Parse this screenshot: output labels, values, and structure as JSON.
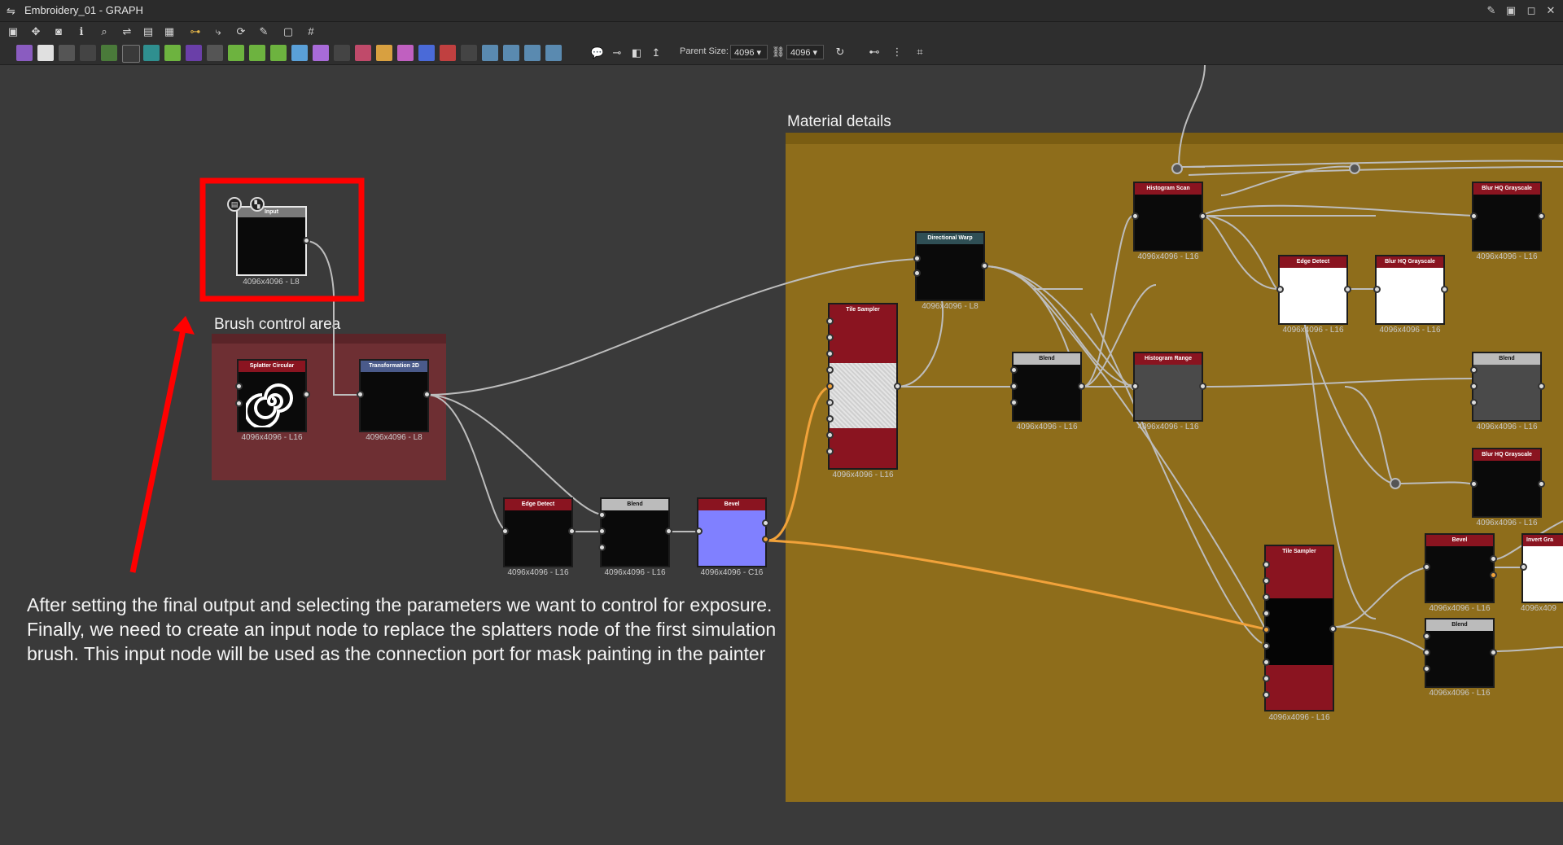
{
  "window": {
    "title": "Embroidery_01 - GRAPH"
  },
  "toolbar": {
    "parent_size_label": "Parent Size:",
    "parent_size_value": "4096",
    "size_value": "4096",
    "icons": [
      "frame-all-icon",
      "pan-icon",
      "camera-icon",
      "info-icon",
      "zoom-icon",
      "link-icon",
      "layout-icon",
      "align-icon",
      "connect-icon",
      "wire-icon",
      "refresh-icon",
      "wrench-icon",
      "snapshot-icon",
      "grid-icon"
    ]
  },
  "frames": {
    "material_details": "Material details",
    "brush_control": "Brush control area"
  },
  "nodes": {
    "input": {
      "title": "Input",
      "size": "4096x4096 - L8"
    },
    "splatter": {
      "title": "Splatter Circular",
      "size": "4096x4096 - L16"
    },
    "transformation": {
      "title": "Transformation 2D",
      "size": "4096x4096 - L8"
    },
    "edge_detect_1": {
      "title": "Edge Detect",
      "size": "4096x4096 - L16"
    },
    "blend_1": {
      "title": "Blend",
      "size": "4096x4096 - L16"
    },
    "bevel_1": {
      "title": "Bevel",
      "size": "4096x4096 - C16"
    },
    "tile_sampler_1": {
      "title": "Tile Sampler",
      "size": "4096x4096 - L16"
    },
    "directional_warp": {
      "title": "Directional Warp",
      "size": "4096x4096 - L8"
    },
    "blend_2": {
      "title": "Blend",
      "size": "4096x4096 - L16"
    },
    "histogram_scan": {
      "title": "Histogram Scan",
      "size": "4096x4096 - L16"
    },
    "histogram_range": {
      "title": "Histogram Range",
      "size": "4096x4096 - L16"
    },
    "edge_detect_2": {
      "title": "Edge Detect",
      "size": "4096x4096 - L16"
    },
    "blur_hq_1": {
      "title": "Blur HQ Grayscale",
      "size": "4096x4096 - L16"
    },
    "blur_hq_2": {
      "title": "Blur HQ Grayscale",
      "size": "4096x4096 - L16"
    },
    "blend_3": {
      "title": "Blend",
      "size": "4096x4096 - L16"
    },
    "blur_hq_3": {
      "title": "Blur HQ Grayscale",
      "size": "4096x4096 - L16"
    },
    "tile_sampler_2": {
      "title": "Tile Sampler",
      "size": "4096x4096 - L16"
    },
    "bevel_2": {
      "title": "Bevel",
      "size": "4096x4096 - L16"
    },
    "invert": {
      "title": "Invert Gra",
      "size": "4096x409"
    },
    "blend_4": {
      "title": "Blend",
      "size": "4096x4096 - L16"
    }
  },
  "annotation": {
    "text": "After setting the final output and selecting the parameters we want to control for exposure. Finally, we need to create an input node to replace the splatters node of the first simulation brush. This input node will be used as the connection port for mask painting in the painter"
  },
  "colors": {
    "canvas": "#3a3a3a",
    "material_frame": "#8e6d1b",
    "brush_frame": "#6e2f33",
    "highlight": "#ff0000",
    "node_header_red": "#8a1420",
    "wire": "#bdbdbd",
    "wire_orange": "#f1a23a"
  }
}
